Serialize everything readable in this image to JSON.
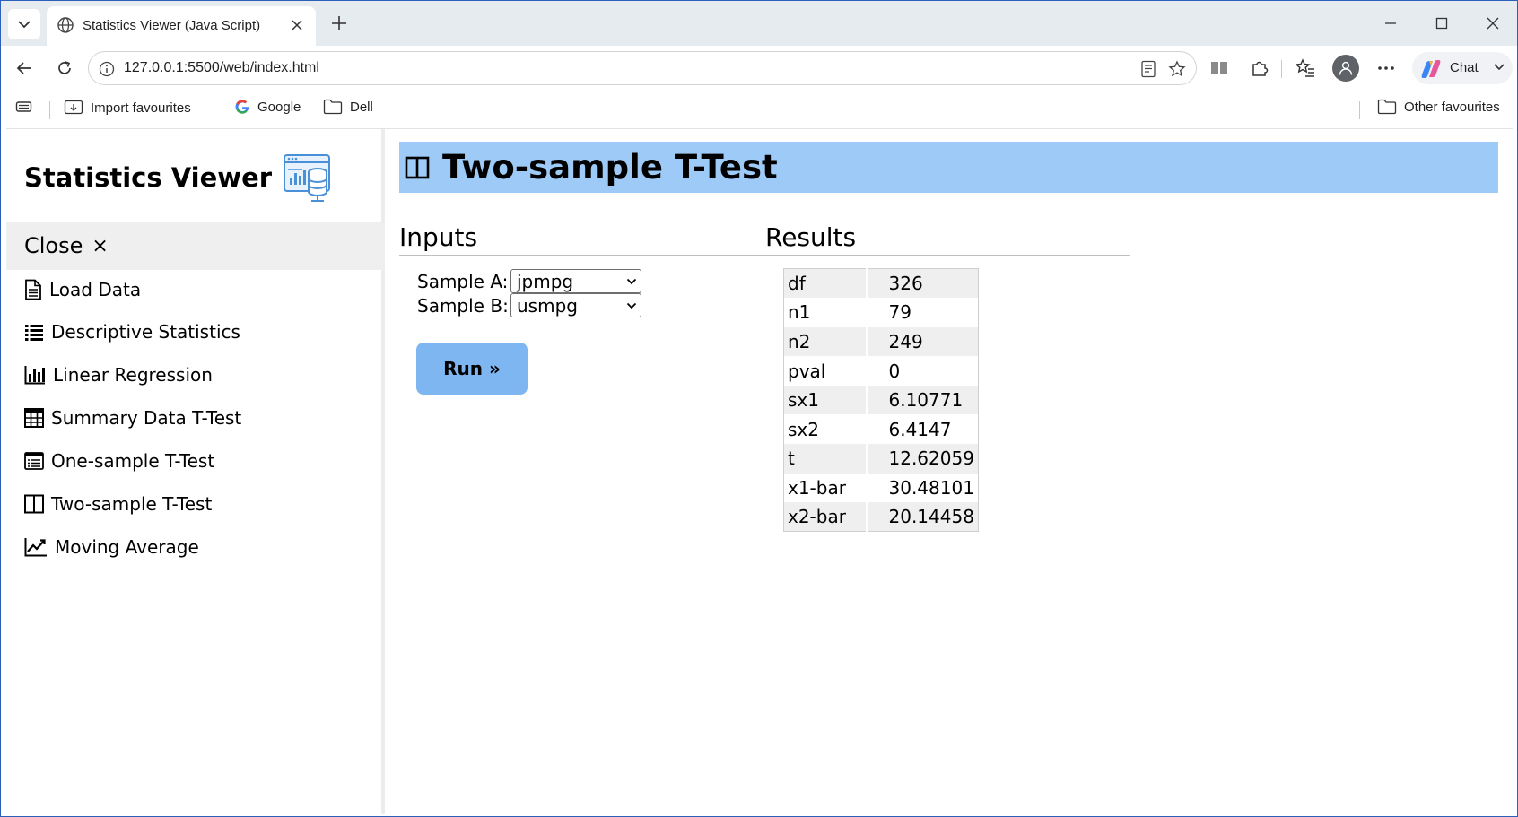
{
  "browser": {
    "tab_title": "Statistics Viewer (Java Script)",
    "url": "127.0.0.1:5500/web/index.html",
    "chat_label": "Chat",
    "favourites": [
      {
        "label": "Import favourites",
        "icon": "import-favourites-icon"
      },
      {
        "label": "Google",
        "icon": "google-icon"
      },
      {
        "label": "Dell",
        "icon": "folder-icon"
      }
    ],
    "other_favourites": "Other favourites"
  },
  "sidebar": {
    "title": "Statistics Viewer",
    "close_label": "Close",
    "close_glyph": "×",
    "items": [
      {
        "label": "Load Data",
        "icon": "document-icon"
      },
      {
        "label": "Descriptive Statistics",
        "icon": "list-icon"
      },
      {
        "label": "Linear Regression",
        "icon": "bar-chart-icon"
      },
      {
        "label": "Summary Data T-Test",
        "icon": "table-icon"
      },
      {
        "label": "One-sample T-Test",
        "icon": "list-box-icon"
      },
      {
        "label": "Two-sample T-Test",
        "icon": "columns-icon"
      },
      {
        "label": "Moving Average",
        "icon": "line-chart-icon"
      }
    ]
  },
  "main": {
    "title": "Two-sample T-Test",
    "inputs_heading": "Inputs",
    "results_heading": "Results",
    "sample_a_label": "Sample A:",
    "sample_a_value": "jpmpg",
    "sample_b_label": "Sample B:",
    "sample_b_value": "usmpg",
    "run_label": "Run »",
    "results": [
      {
        "key": "df",
        "value": "326"
      },
      {
        "key": "n1",
        "value": "79"
      },
      {
        "key": "n2",
        "value": "249"
      },
      {
        "key": "pval",
        "value": "0"
      },
      {
        "key": "sx1",
        "value": "6.10771"
      },
      {
        "key": "sx2",
        "value": "6.4147"
      },
      {
        "key": "t",
        "value": "12.62059"
      },
      {
        "key": "x1-bar",
        "value": "30.48101"
      },
      {
        "key": "x2-bar",
        "value": "20.14458"
      }
    ]
  },
  "colors": {
    "header_bar": "#9ecaf7",
    "run_button": "#7db6f0",
    "accent_border": "#2b5fb8"
  }
}
